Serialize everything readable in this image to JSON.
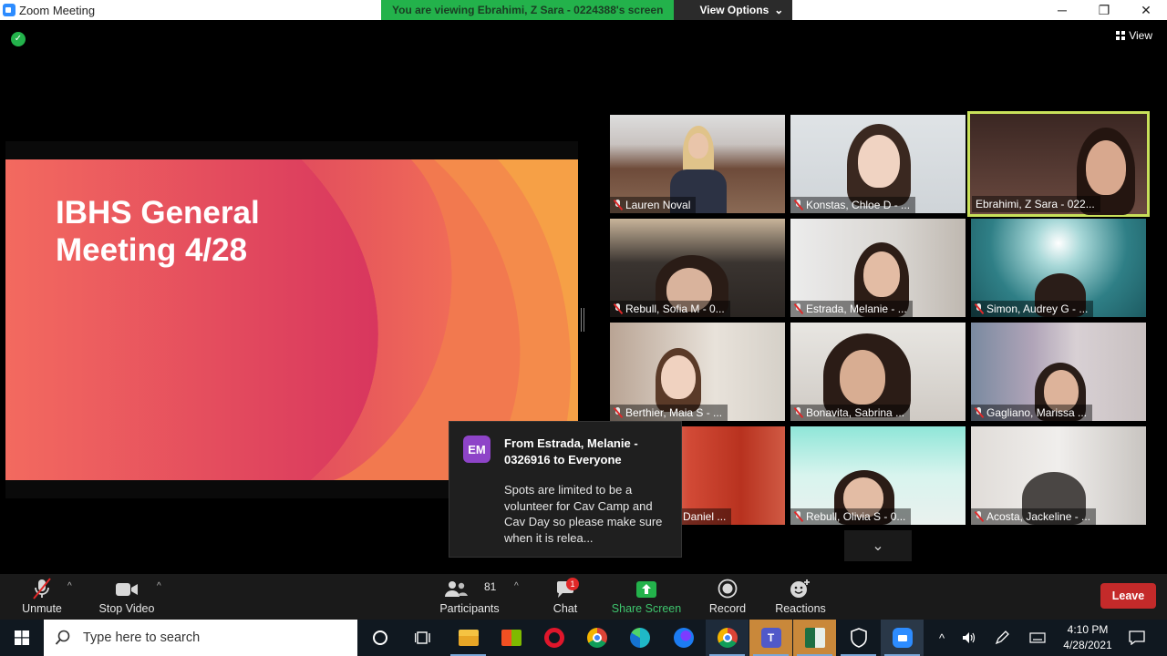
{
  "window": {
    "title": "Zoom Meeting",
    "controls": {
      "minimize": "─",
      "maximize": "❐",
      "close": "✕"
    }
  },
  "banner": {
    "viewing_text": "You are viewing Ebrahimi, Z Sara - 0224388's screen",
    "view_options_label": "View Options",
    "view_options_caret": "⌄"
  },
  "top_right": {
    "view_label": "View"
  },
  "slide": {
    "title_line1": "IBHS General",
    "title_line2": "Meeting 4/28"
  },
  "participants_gallery": [
    {
      "name": "Lauren Noval",
      "active": false
    },
    {
      "name": "Konstas, Chloe D - ...",
      "active": false
    },
    {
      "name": "Ebrahimi, Z Sara - 022...",
      "active": true
    },
    {
      "name": "Rebull, Sofia M - 0...",
      "active": false
    },
    {
      "name": "Estrada, Melanie - ...",
      "active": false
    },
    {
      "name": "Simon, Audrey G - ...",
      "active": false
    },
    {
      "name": "Berthier, Maia S - ...",
      "active": false
    },
    {
      "name": "Bonavita, Sabrina ...",
      "active": false
    },
    {
      "name": "Gagliano, Marissa ...",
      "active": false
    },
    {
      "name": "Daniel ...",
      "active": false
    },
    {
      "name": "Rebull, Olivia S - 0...",
      "active": false
    },
    {
      "name": "Acosta, Jackeline - ...",
      "active": false
    }
  ],
  "gallery_scroll": {
    "icon": "⌄"
  },
  "chat_notification": {
    "avatar_initials": "EM",
    "from": "From Estrada, Melanie - 0326916 to Everyone",
    "message": "Spots are limited to be a volunteer for Cav Camp and Cav Day so please make sure when it is relea..."
  },
  "toolbar": {
    "unmute_label": "Unmute",
    "stop_video_label": "Stop Video",
    "participants_label": "Participants",
    "participants_count": "81",
    "chat_label": "Chat",
    "chat_badge": "1",
    "share_screen_label": "Share Screen",
    "record_label": "Record",
    "reactions_label": "Reactions",
    "leave_label": "Leave",
    "caret": "^"
  },
  "taskbar": {
    "search_placeholder": "Type here to search",
    "time": "4:10 PM",
    "date": "4/28/2021",
    "tray_chevron": "^",
    "icons": [
      "cortana-icon",
      "task-view-icon",
      "file-explorer-icon",
      "store-icon",
      "opera-icon",
      "chrome-icon",
      "edge-icon",
      "firefox-icon",
      "chrome-icon-2",
      "teams-icon",
      "excel-icon",
      "defender-icon",
      "zoom-icon"
    ]
  },
  "colors": {
    "accent_blue": "#2d8cff",
    "banner_green": "#23b24b",
    "leave_red": "#c42a2a",
    "active_speaker": "#c8e05a"
  }
}
